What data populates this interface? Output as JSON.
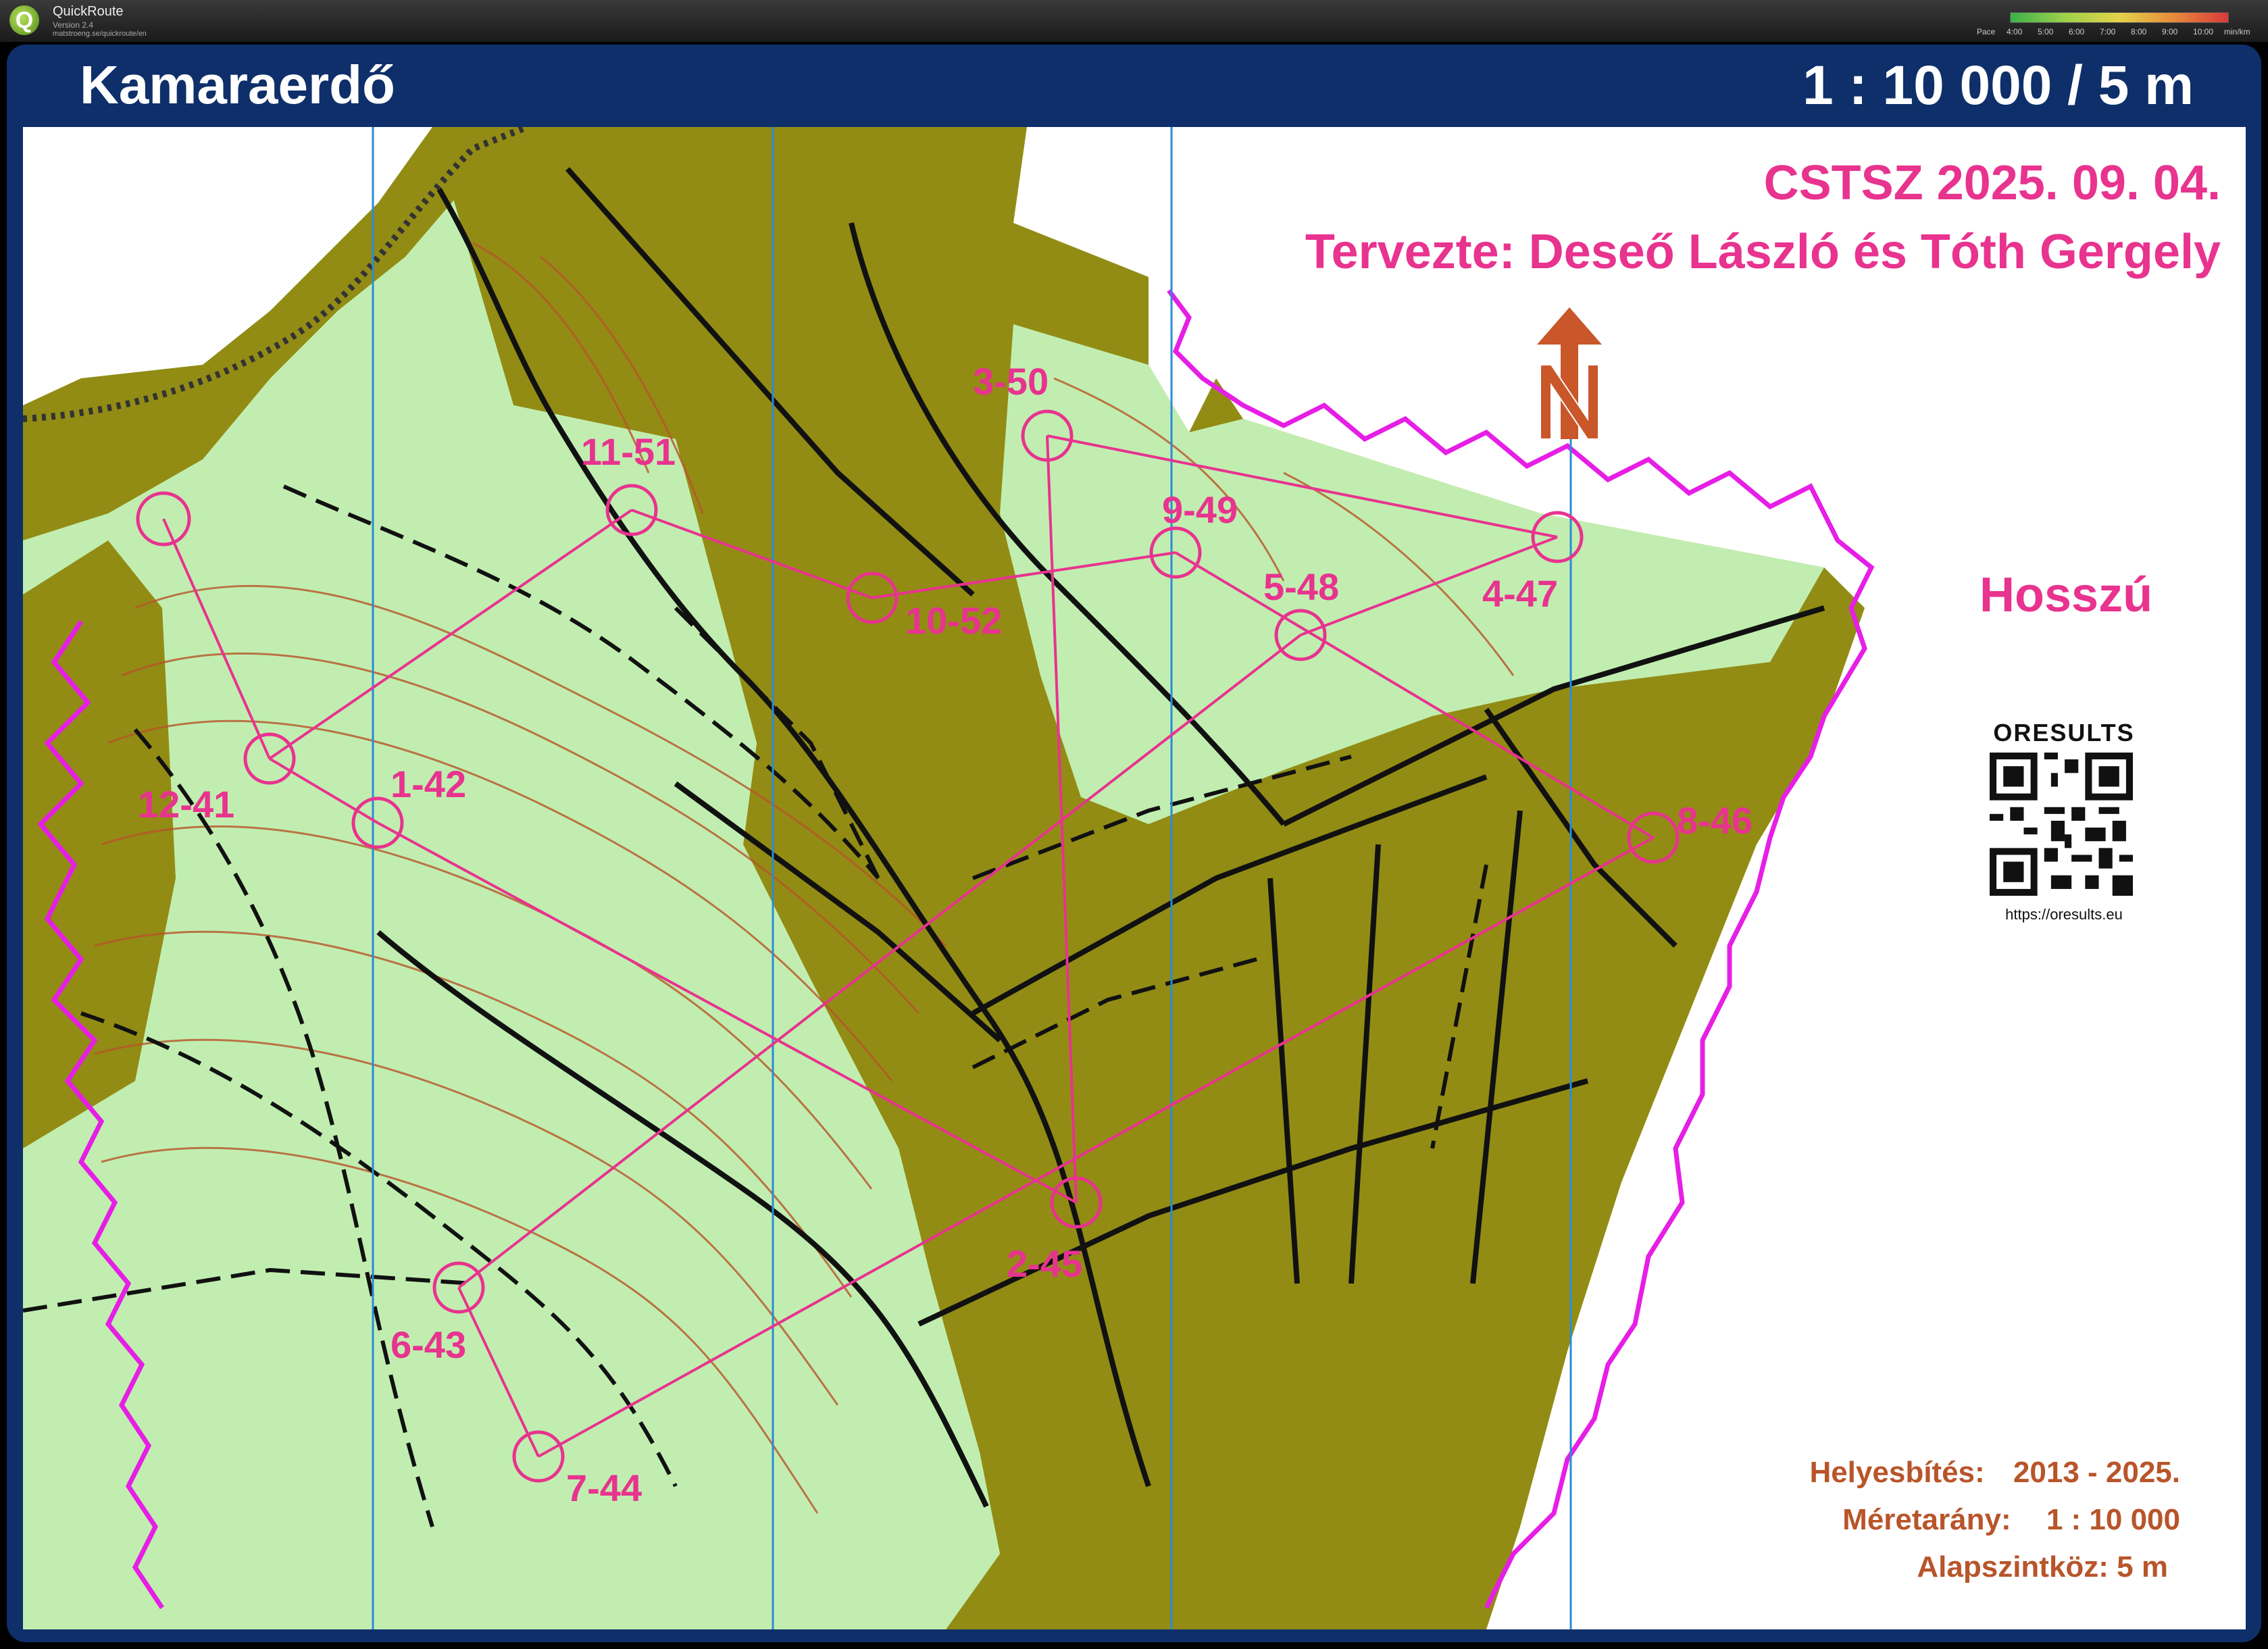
{
  "app": {
    "name": "QuickRoute",
    "version": "Version 2.4",
    "url": "matstroeng.se/quickroute/en"
  },
  "pace_legend": {
    "title": "Pace",
    "ticks": [
      "4:00",
      "5:00",
      "6:00",
      "7:00",
      "8:00",
      "9:00",
      "10:00"
    ],
    "unit": "min/km"
  },
  "map": {
    "title": "Kamaraerdő",
    "scale": "1 : 10 000 / 5 m",
    "event": "CSTSZ 2025. 09. 04.",
    "designer": "Tervezte: Deseő László és Tóth Gergely",
    "course": "Hosszú",
    "oresults_logo": "ORESULTS",
    "oresults_url": "https://oresults.eu",
    "info": [
      {
        "label": "Helyesbítés:",
        "value": "2013 - 2025."
      },
      {
        "label": "Méretarány:",
        "value": "1 : 10 000"
      },
      {
        "label": "Alapszintköz: 5 m",
        "value": ""
      }
    ]
  },
  "controls": [
    "1-42",
    "2-45",
    "3-50",
    "4-47",
    "5-48",
    "6-43",
    "7-44",
    "8-46",
    "9-49",
    "10-52",
    "11-51",
    "12-41"
  ],
  "colors": {
    "frame": "#0e2f6a",
    "course": "#e8338f",
    "forest_light": "#c1eeb0",
    "forest_dense": "#928c14",
    "contour": "#b8552a",
    "north_arrow": "#c9572a"
  }
}
